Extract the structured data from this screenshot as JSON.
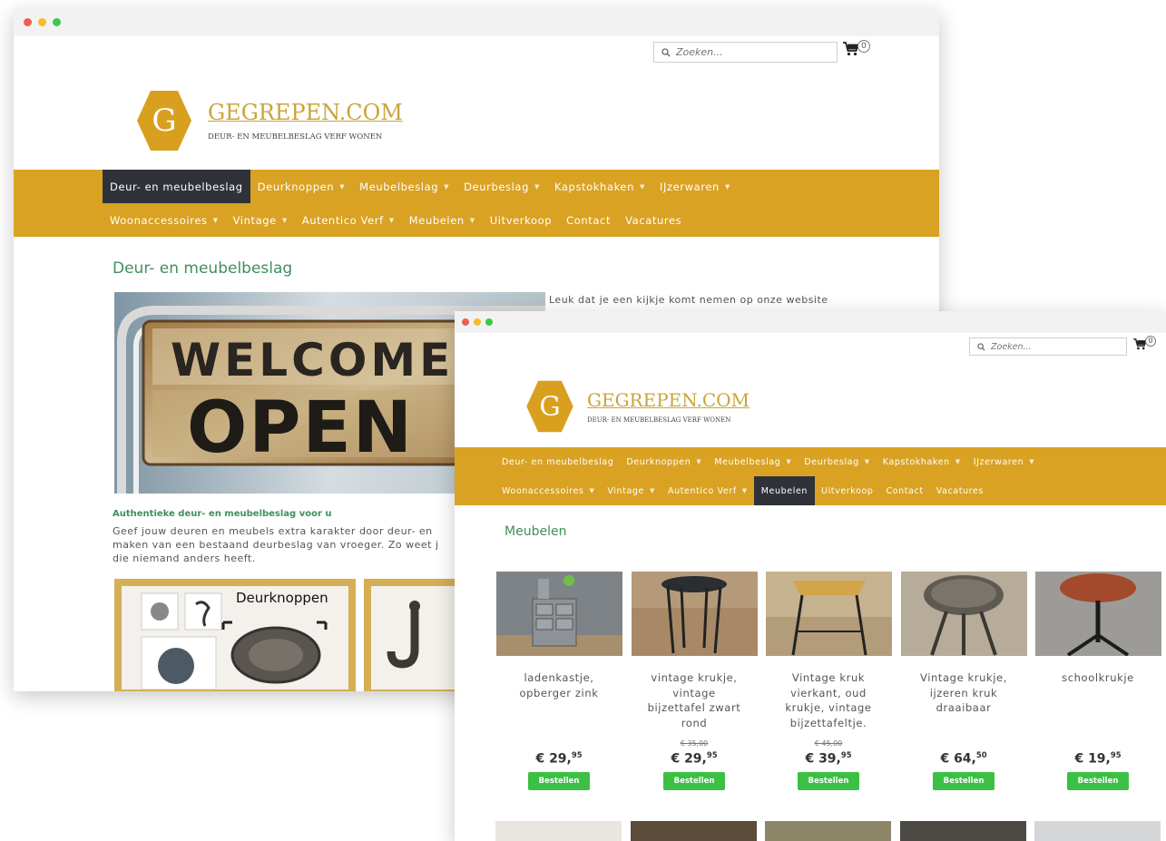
{
  "site": {
    "logo_letter": "G",
    "logo_title": "GEGREPEN.COM",
    "logo_tagline": "DEUR- EN MEUBELBESLAG VERF WONEN",
    "search_placeholder": "Zoeken...",
    "cart_count": "0"
  },
  "colors": {
    "nav": "#d9a223",
    "active": "#2f3238",
    "title": "#3f8f5e",
    "order_button": "#3bc043"
  },
  "nav": {
    "row1": [
      {
        "label": "Deur- en meubelbeslag",
        "caret": false
      },
      {
        "label": "Deurknoppen",
        "caret": true
      },
      {
        "label": "Meubelbeslag",
        "caret": true
      },
      {
        "label": "Deurbeslag",
        "caret": true
      },
      {
        "label": "Kapstokhaken",
        "caret": true
      },
      {
        "label": "IJzerwaren",
        "caret": true
      }
    ],
    "row2": [
      {
        "label": "Woonaccessoires",
        "caret": true
      },
      {
        "label": "Vintage",
        "caret": true
      },
      {
        "label": "Autentico Verf",
        "caret": true
      },
      {
        "label": "Meubelen",
        "caret": true
      },
      {
        "label": "Uitverkoop",
        "caret": false
      },
      {
        "label": "Contact",
        "caret": false
      },
      {
        "label": "Vacatures",
        "caret": false
      }
    ]
  },
  "win1": {
    "page_title": "Deur- en meubelbeslag",
    "intro": "Leuk dat je een kijkje komt nemen op onze website",
    "sign_words": [
      "WELCOME",
      "OPEN"
    ],
    "subheading": "Authentieke deur- en meubelbeslag voor u",
    "paragraph_lines": [
      "Geef jouw deuren en meubels extra karakter door deur- en",
      "maken van een bestaand deurbeslag van vroeger. Zo weet j",
      "die niemand anders heeft."
    ],
    "category_tile": "Deurknoppen"
  },
  "win2": {
    "page_title": "Meubelen",
    "order_label": "Bestellen",
    "products": [
      {
        "name_lines": [
          "ladenkastje,",
          "opberger zink"
        ],
        "old_price": "",
        "price_main": "€ 29,",
        "price_cents": "95"
      },
      {
        "name_lines": [
          "vintage krukje,",
          "vintage",
          "bijzettafel zwart",
          "rond"
        ],
        "old_price": "€ 35,00",
        "price_main": "€ 29,",
        "price_cents": "95"
      },
      {
        "name_lines": [
          "Vintage kruk",
          "vierkant, oud",
          "krukje, vintage",
          "bijzettafeltje."
        ],
        "old_price": "€ 45,00",
        "price_main": "€ 39,",
        "price_cents": "95"
      },
      {
        "name_lines": [
          "Vintage krukje,",
          "ijzeren kruk",
          "draaibaar"
        ],
        "old_price": "",
        "price_main": "€ 64,",
        "price_cents": "50"
      },
      {
        "name_lines": [
          "schoolkrukje"
        ],
        "old_price": "",
        "price_main": "€ 19,",
        "price_cents": "95"
      }
    ]
  }
}
